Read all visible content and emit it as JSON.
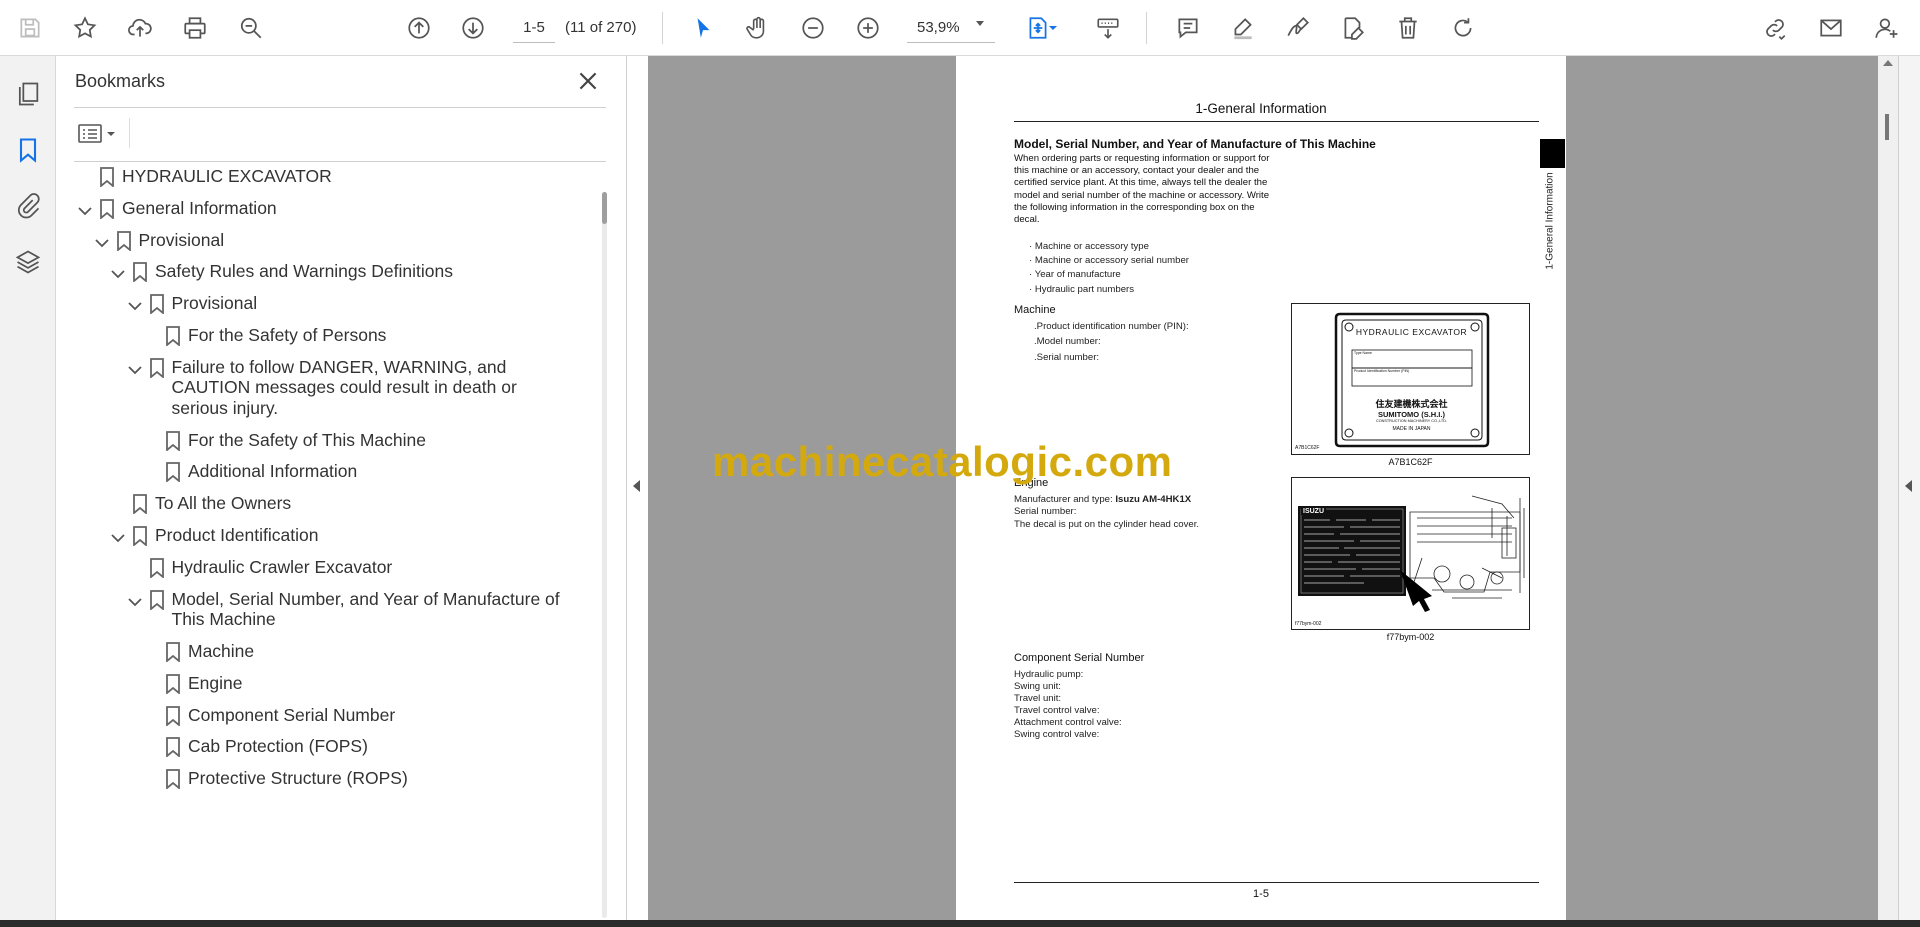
{
  "toolbar": {
    "page_input": "1-5",
    "page_count": "(11 of 270)",
    "zoom": "53,9%"
  },
  "panel": {
    "title": "Bookmarks"
  },
  "bookmarks": [
    {
      "label": "HYDRAULIC EXCAVATOR",
      "level": 0,
      "expanded": null
    },
    {
      "label": "General Information",
      "level": 0,
      "expanded": true
    },
    {
      "label": "Provisional",
      "level": 1,
      "expanded": true
    },
    {
      "label": "Safety Rules and Warnings Definitions",
      "level": 2,
      "expanded": true
    },
    {
      "label": "Provisional",
      "level": 3,
      "expanded": true
    },
    {
      "label": "For the Safety of Persons",
      "level": 4,
      "expanded": null
    },
    {
      "label": "Failure to follow DANGER, WARNING, and CAUTION messages could result in death or serious injury.",
      "level": 3,
      "expanded": true
    },
    {
      "label": "For the Safety of This Machine",
      "level": 4,
      "expanded": null
    },
    {
      "label": "Additional Information",
      "level": 4,
      "expanded": null
    },
    {
      "label": "To All the Owners",
      "level": 2,
      "expanded": null
    },
    {
      "label": "Product Identification",
      "level": 2,
      "expanded": true
    },
    {
      "label": "Hydraulic Crawler Excavator",
      "level": 3,
      "expanded": null
    },
    {
      "label": "Model, Serial Number, and Year of Manufacture of This Machine",
      "level": 3,
      "expanded": true
    },
    {
      "label": "Machine",
      "level": 4,
      "expanded": null
    },
    {
      "label": "Engine",
      "level": 4,
      "expanded": null
    },
    {
      "label": "Component Serial Number",
      "level": 4,
      "expanded": null
    },
    {
      "label": "Cab Protection (FOPS)",
      "level": 4,
      "expanded": null
    },
    {
      "label": "Protective Structure (ROPS)",
      "level": 4,
      "expanded": null
    }
  ],
  "document": {
    "header": "1-General Information",
    "side_tab": "1-General Information",
    "heading": "Model, Serial Number, and Year of Manufacture of This Machine",
    "intro": "When ordering parts or requesting information or support for this machine or an accessory, contact your dealer and the certified service plant. At this time, always tell the dealer the model and serial number of the machine or accessory. Write the following information in the corresponding box on the decal.",
    "bullets": [
      "Machine or accessory type",
      "Machine or accessory serial number",
      "Year of manufacture",
      "Hydraulic part numbers"
    ],
    "machine_heading": "Machine",
    "machine_lines": [
      ".Product identification number (PIN):",
      ".Model number:",
      ".Serial number:"
    ],
    "figure1": {
      "plate_title": "HYDRAULIC EXCAVATOR",
      "row1": "Type Name",
      "row2": "Product Identification Number (PIN)",
      "maker_jp": "住友建機株式会社",
      "maker": "SUMITOMO (S.H.I.)",
      "maker_sub": "CONSTRUCTION MACHINERY CO.,LTD.",
      "origin": "MADE IN JAPAN",
      "code": "A7B1C62F",
      "caption": "A7B1C62F"
    },
    "engine_heading": "Engine",
    "engine_mfr_label": "Manufacturer and type: ",
    "engine_mfr_value": "Isuzu AM-4HK1X",
    "engine_serial": "Serial number:",
    "engine_decal": "The decal is put on the cylinder head cover.",
    "figure2": {
      "brand": "ISUZU",
      "code": "f77bym-002",
      "caption": "f77bym-002"
    },
    "component_heading": "Component Serial Number",
    "component_lines": [
      "Hydraulic pump:",
      "Swing unit:",
      "Travel unit:",
      "Travel control valve:",
      "Attachment control valve:",
      "Swing control valve:"
    ],
    "page_number": "1-5"
  },
  "watermark": "machinecatalogic.com",
  "icons": {
    "toolbar": [
      "save-icon",
      "star-icon",
      "upload-icon",
      "print-icon",
      "zoom-search-icon",
      "page-up-icon",
      "page-down-icon",
      "select-arrow-icon",
      "hand-icon",
      "zoom-out-icon",
      "zoom-in-icon",
      "fit-page-icon",
      "scroll-mode-icon",
      "comment-icon",
      "highlight-icon",
      "sign-icon",
      "edit-pdf-icon",
      "delete-icon",
      "rotate-icon",
      "share-link-icon",
      "email-icon",
      "account-icon"
    ],
    "rail": [
      "pages-icon",
      "bookmark-icon",
      "attachment-icon",
      "layers-icon"
    ]
  },
  "colors": {
    "accent": "#1473e6",
    "watermark": "#d4a90d",
    "doc_background": "#9b9b9b"
  }
}
